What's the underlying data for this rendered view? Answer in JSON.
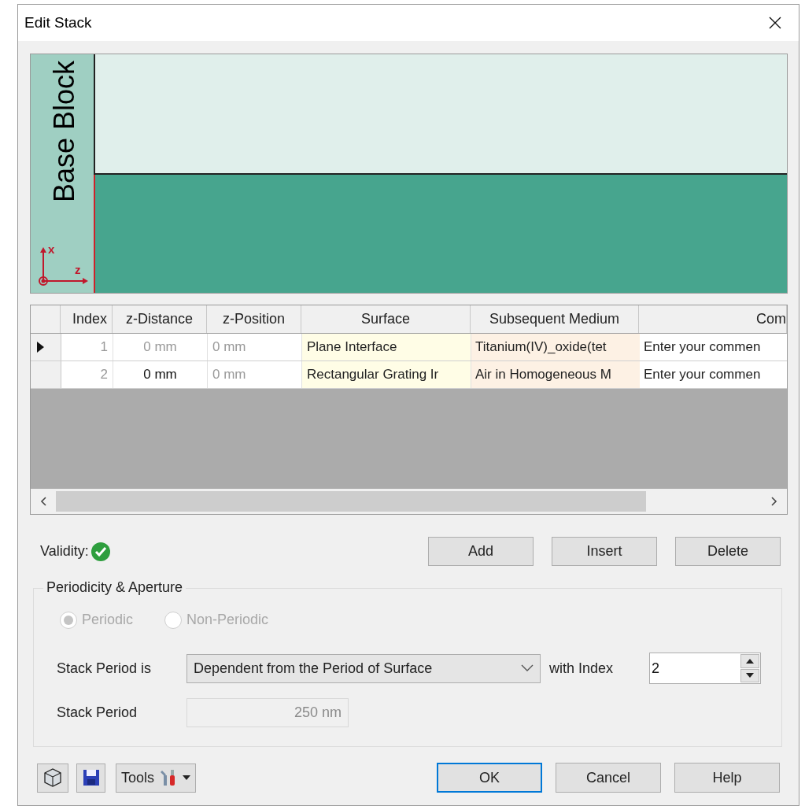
{
  "window": {
    "title": "Edit Stack"
  },
  "canvas": {
    "block_label": "Base Block",
    "axis_labels": [
      "x",
      "z"
    ]
  },
  "table": {
    "columns": [
      "Index",
      "z-Distance",
      "z-Position",
      "Surface",
      "Subsequent Medium",
      "Com"
    ],
    "rows": [
      {
        "selected": true,
        "index": "1",
        "distance": "0 mm",
        "distance_editable": false,
        "position": "0 mm",
        "surface": "Plane Interface",
        "medium": "Titanium(IV)_oxide(tet",
        "comment": "Enter your commen"
      },
      {
        "selected": false,
        "index": "2",
        "distance": "0 mm",
        "distance_editable": true,
        "position": "0 mm",
        "surface": "Rectangular Grating Ir",
        "medium": "Air in Homogeneous M",
        "comment": "Enter your commen"
      }
    ]
  },
  "validity": {
    "label": "Validity:",
    "valid": true
  },
  "row_buttons": [
    "Add",
    "Insert",
    "Delete"
  ],
  "periodicity": {
    "title": "Periodicity & Aperture",
    "radios": [
      {
        "label": "Periodic",
        "selected": true,
        "disabled": true
      },
      {
        "label": "Non-Periodic",
        "selected": false,
        "disabled": true
      }
    ],
    "period_is_label": "Stack Period is",
    "period_is_value": "Dependent from the Period of Surface",
    "with_index_label": "with Index",
    "index_value": "2",
    "period_label": "Stack Period",
    "period_value": "250 nm"
  },
  "footer": {
    "tools_label": "Tools",
    "buttons": [
      {
        "label": "OK",
        "default": true
      },
      {
        "label": "Cancel",
        "default": false
      },
      {
        "label": "Help",
        "default": false
      }
    ]
  }
}
